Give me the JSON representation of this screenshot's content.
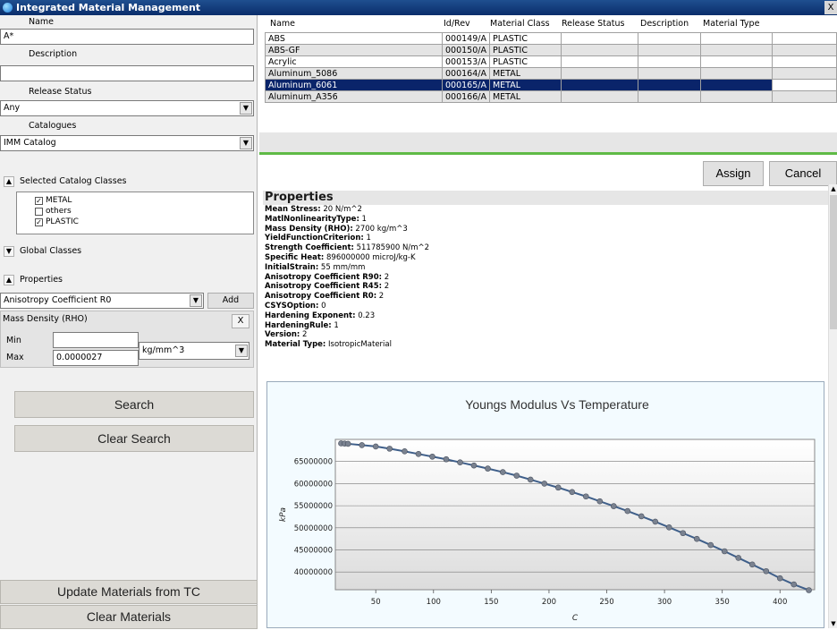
{
  "window": {
    "title": "Integrated Material Management",
    "close_label": "X"
  },
  "search_panel": {
    "name_label": "Name",
    "name_value": "A*",
    "description_label": "Description",
    "description_value": "",
    "release_status_label": "Release Status",
    "release_status_value": "Any",
    "catalogues_label": "Catalogues",
    "catalogue_value": "IMM Catalog",
    "selected_classes_label": "Selected Catalog Classes",
    "classes": [
      {
        "label": "METAL",
        "checked": true
      },
      {
        "label": "others",
        "checked": false
      },
      {
        "label": "PLASTIC",
        "checked": true
      }
    ],
    "global_classes_label": "Global Classes",
    "properties_label": "Properties",
    "property_value": "Anisotropy Coefficient R0",
    "add_label": "Add",
    "filter": {
      "title": "Mass Density (RHO)",
      "remove_label": "X",
      "min_label": "Min",
      "min_value": "",
      "max_label": "Max",
      "max_value": "0.0000027",
      "unit_value": "kg/mm^3"
    },
    "search_label": "Search",
    "clear_search_label": "Clear Search",
    "update_materials_label": "Update Materials from TC",
    "clear_materials_label": "Clear Materials"
  },
  "results": {
    "columns": [
      "Name",
      "Id/Rev",
      "Material Class",
      "Release Status",
      "Description",
      "Material Type"
    ],
    "rows": [
      {
        "name": "ABS",
        "id": "000149/A",
        "class": "PLASTIC"
      },
      {
        "name": "ABS-GF",
        "id": "000150/A",
        "class": "PLASTIC"
      },
      {
        "name": "Acrylic",
        "id": "000153/A",
        "class": "PLASTIC"
      },
      {
        "name": "Aluminum_5086",
        "id": "000164/A",
        "class": "METAL"
      },
      {
        "name": "Aluminum_6061",
        "id": "000165/A",
        "class": "METAL"
      },
      {
        "name": "Aluminum_A356",
        "id": "000166/A",
        "class": "METAL"
      }
    ],
    "selected_row": "Aluminum_6061"
  },
  "actions": {
    "assign_label": "Assign",
    "cancel_label": "Cancel"
  },
  "properties": {
    "title": "Properties",
    "items": [
      {
        "key": "Mean Stress:",
        "value": " 20 N/m^2"
      },
      {
        "key": "MatlNonlinearityType:",
        "value": " 1"
      },
      {
        "key": "Mass Density (RHO):",
        "value": " 2700 kg/m^3"
      },
      {
        "key": "YieldFunctionCriterion:",
        "value": " 1"
      },
      {
        "key": "Strength Coefficient:",
        "value": " 511785900 N/m^2"
      },
      {
        "key": "Specific Heat:",
        "value": " 896000000 microJ/kg-K"
      },
      {
        "key": "InitialStrain:",
        "value": " 55 mm/mm"
      },
      {
        "key": "Anisotropy Coefficient R90:",
        "value": " 2"
      },
      {
        "key": "Anisotropy Coefficient R45:",
        "value": " 2"
      },
      {
        "key": "Anisotropy Coefficient R0:",
        "value": " 2"
      },
      {
        "key": "CSYSOption:",
        "value": " 0"
      },
      {
        "key": "Hardening Exponent:",
        "value": " 0.23"
      },
      {
        "key": "HardeningRule:",
        "value": " 1"
      },
      {
        "key": "Version:",
        "value": " 2"
      },
      {
        "key": "Material Type:",
        "value": " IsotropicMaterial"
      }
    ]
  },
  "chart_data": {
    "type": "line",
    "title": "Youngs Modulus Vs Temperature",
    "xlabel": "C",
    "ylabel": "kPa",
    "xlim": [
      15,
      430
    ],
    "ylim": [
      36000000,
      70000000
    ],
    "xticks": [
      50,
      100,
      150,
      200,
      250,
      300,
      350,
      400
    ],
    "yticks": [
      40000000,
      45000000,
      50000000,
      55000000,
      60000000,
      65000000
    ],
    "ytick_labels": [
      "40000000",
      "45000000",
      "50000000",
      "55000000",
      "60000000",
      "65000000"
    ],
    "x": [
      20,
      23,
      26,
      38,
      50,
      62,
      75,
      87,
      99,
      111,
      123,
      135,
      147,
      160,
      172,
      184,
      196,
      208,
      220,
      232,
      244,
      256,
      268,
      280,
      292,
      304,
      316,
      328,
      340,
      352,
      364,
      376,
      388,
      400,
      412,
      425
    ],
    "y": [
      69100000,
      69050000,
      69000000,
      68700000,
      68400000,
      67900000,
      67300000,
      66700000,
      66100000,
      65500000,
      64800000,
      64100000,
      63400000,
      62600000,
      61800000,
      60900000,
      60000000,
      59100000,
      58100000,
      57100000,
      56000000,
      54900000,
      53800000,
      52600000,
      51400000,
      50100000,
      48800000,
      47500000,
      46100000,
      44700000,
      43200000,
      41700000,
      40200000,
      38600000,
      37200000,
      35900000
    ],
    "line_color": "#3f5f8a",
    "grid": true
  }
}
